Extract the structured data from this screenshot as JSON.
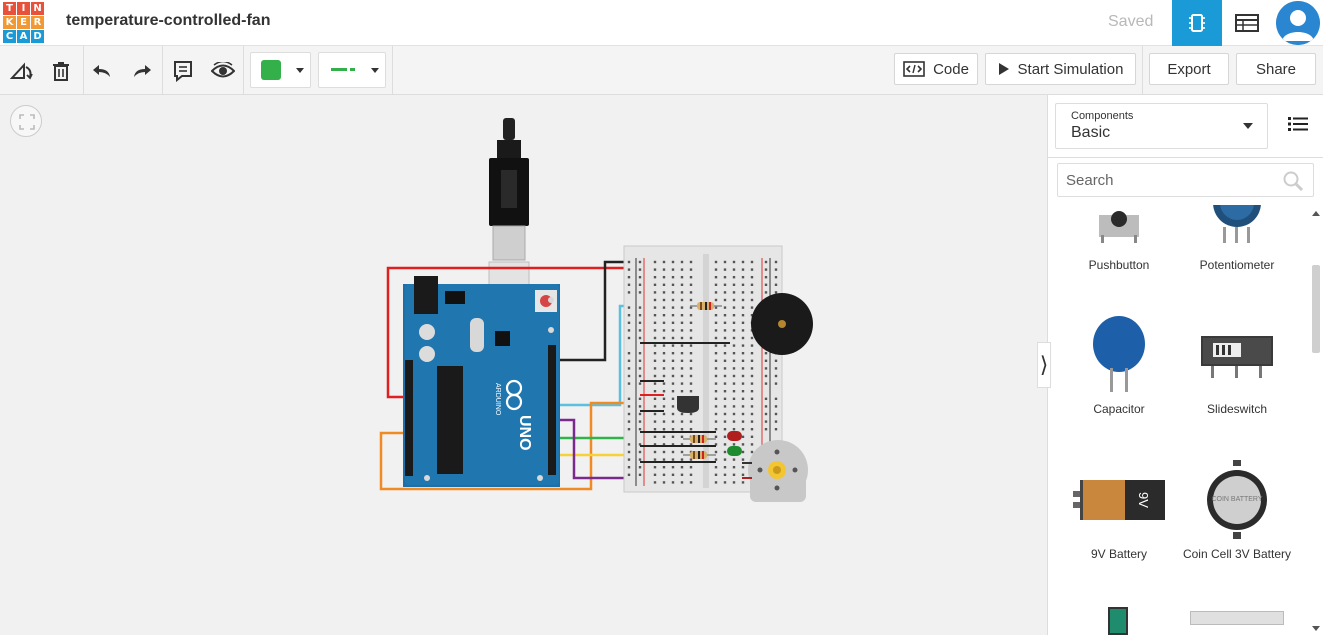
{
  "header": {
    "logo_letters": [
      "T",
      "I",
      "N",
      "K",
      "E",
      "R",
      "C",
      "A",
      "D"
    ],
    "logo_colors": [
      "#e8513a",
      "#e8513a",
      "#e8513a",
      "#f29a31",
      "#f29a31",
      "#f29a31",
      "#1a9bd7",
      "#1a9bd7",
      "#1a9bd7"
    ],
    "project_title": "temperature-controlled-fan",
    "save_status": "Saved"
  },
  "toolbar": {
    "code_label": "Code",
    "simulate_label": "Start Simulation",
    "export_label": "Export",
    "share_label": "Share",
    "wire_color": "#34b04a"
  },
  "sidebar": {
    "components_label": "Components",
    "components_value": "Basic",
    "search_placeholder": "Search",
    "items": [
      {
        "label": "Pushbutton"
      },
      {
        "label": "Potentiometer"
      },
      {
        "label": "Capacitor"
      },
      {
        "label": "Slideswitch"
      },
      {
        "label": "9V Battery"
      },
      {
        "label": "Coin Cell 3V Battery"
      }
    ]
  },
  "circuit": {
    "board_label": "UNO",
    "brand_label": "ARDUINO",
    "battery_text": "9V",
    "coin_text": "COIN BATTERY"
  }
}
